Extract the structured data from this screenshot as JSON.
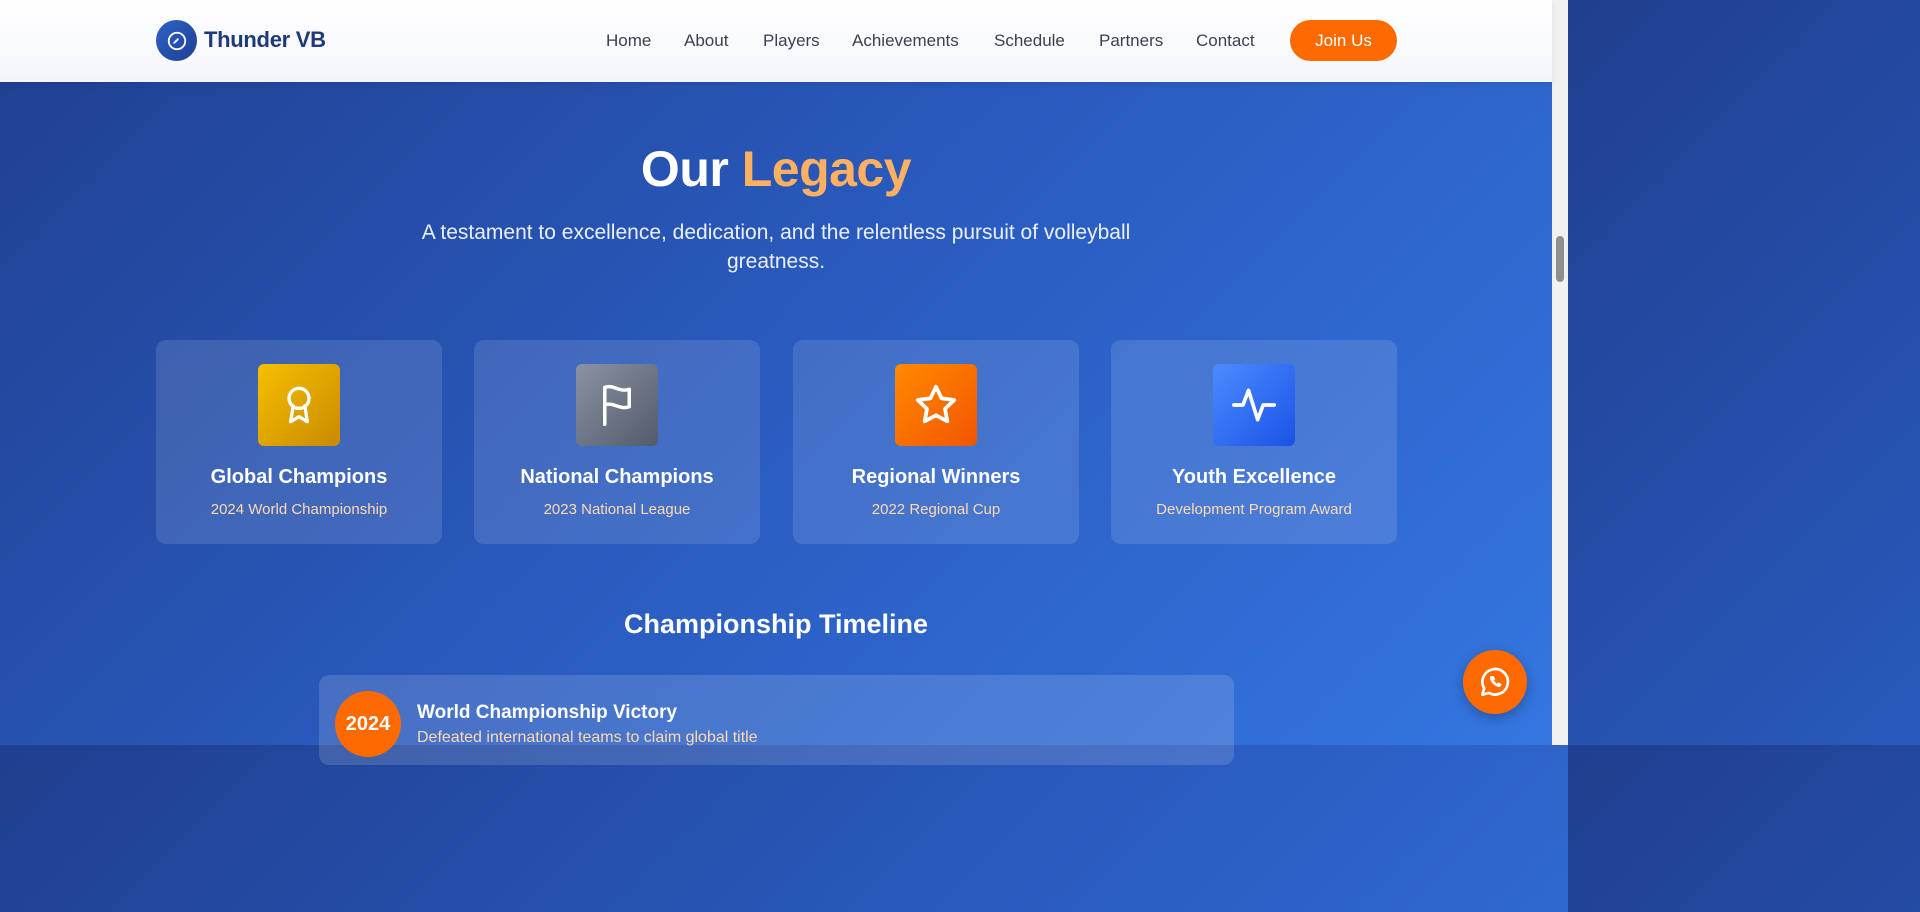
{
  "brand": {
    "name": "Thunder VB",
    "icon": "volleyball-icon"
  },
  "nav": {
    "links": [
      "Home",
      "About",
      "Players",
      "Achievements",
      "Schedule",
      "Partners",
      "Contact"
    ],
    "cta": "Join Us"
  },
  "hero": {
    "title_main": "Our",
    "title_accent": "Legacy",
    "subtitle": "A testament to excellence, dedication, and the relentless pursuit of volleyball greatness."
  },
  "cards": [
    {
      "title": "Global Champions",
      "subtitle": "2024 World Championship",
      "icon": "award-ribbon-icon",
      "color": "#e6a800"
    },
    {
      "title": "National Champions",
      "subtitle": "2023 National League",
      "icon": "flag-icon",
      "color": "#6b7280"
    },
    {
      "title": "Regional Winners",
      "subtitle": "2022 Regional Cup",
      "icon": "star-icon",
      "color": "#ff6a00"
    },
    {
      "title": "Youth Excellence",
      "subtitle": "Development Program Award",
      "icon": "activity-icon",
      "color": "#2f6bff"
    }
  ],
  "timeline": {
    "title": "Championship Timeline",
    "items": [
      {
        "year": "2024",
        "title": "World Championship Victory",
        "description": "Defeated international teams to claim global title"
      }
    ]
  },
  "colors": {
    "accent": "#ff6a00",
    "title_accent": "#ffb060",
    "brand_dark": "#1f3a7a"
  }
}
